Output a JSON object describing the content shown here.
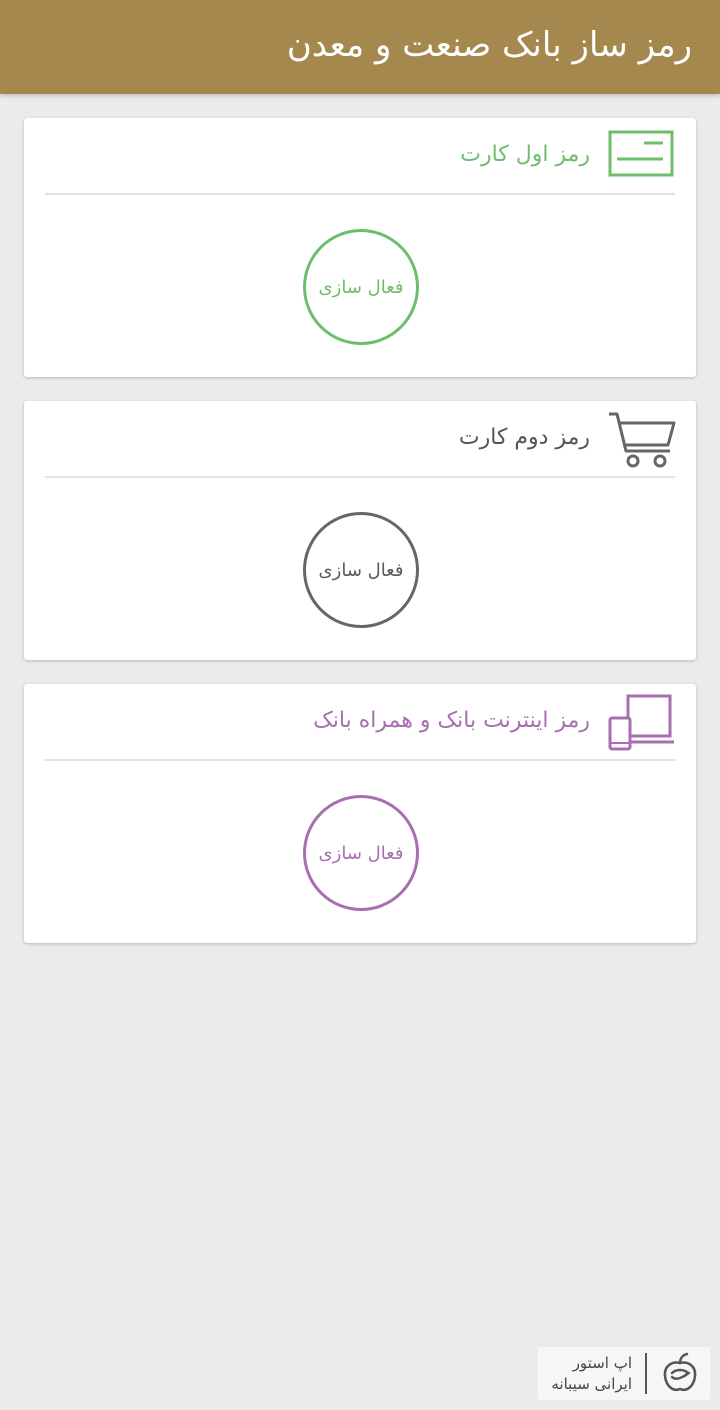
{
  "header": {
    "title": "رمز ساز بانک صنعت و معدن"
  },
  "cards": [
    {
      "title": "رمز اول کارت",
      "icon": "card-icon",
      "color": "#6dbd6a",
      "button_label": "فعال سازی"
    },
    {
      "title": "رمز دوم کارت",
      "icon": "shopping-cart-icon",
      "color": "#666666",
      "button_label": "فعال سازی"
    },
    {
      "title": "رمز اینترنت بانک و همراه بانک",
      "icon": "devices-icon",
      "color": "#a86fb0",
      "button_label": "فعال سازی"
    }
  ],
  "watermark": {
    "line1": "اپ استور",
    "line2": "ایرانی سیبانه",
    "icon": "apple-logo-icon"
  }
}
